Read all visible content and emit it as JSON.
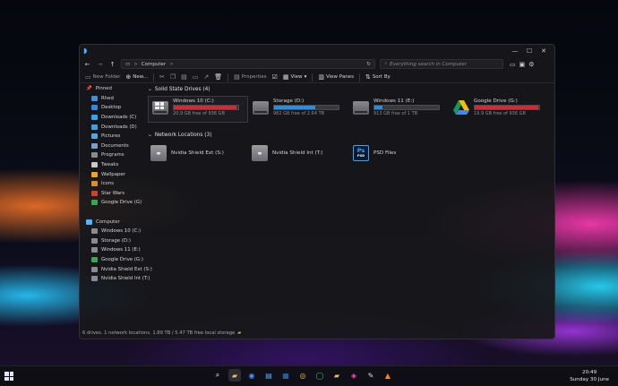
{
  "window": {
    "address": {
      "segments": [
        "Computer"
      ],
      "separator": ">"
    },
    "search": {
      "placeholder": "Everything search in Computer"
    },
    "toolbar": {
      "new_folder": "New Folder",
      "new": "New...",
      "properties": "Properties",
      "view": "View",
      "view_panes": "View Panes",
      "sort_by": "Sort By"
    },
    "sidebar": {
      "pinned_label": "Pinned",
      "pinned": [
        {
          "label": "Rhed",
          "color": "#3d8fe0"
        },
        {
          "label": "Desktop",
          "color": "#2f86e6"
        },
        {
          "label": "Downloads (C)",
          "color": "#3aa0e8"
        },
        {
          "label": "Downloads (D)",
          "color": "#3aa0e8"
        },
        {
          "label": "Pictures",
          "color": "#4fa6e8"
        },
        {
          "label": "Documents",
          "color": "#7aa0c8"
        },
        {
          "label": "Programs",
          "color": "#8a8a92"
        },
        {
          "label": "Tweaks",
          "color": "#c8c8c8"
        },
        {
          "label": "Wallpaper",
          "color": "#f0a030"
        },
        {
          "label": "Icons",
          "color": "#e08a30"
        },
        {
          "label": "Star Wars",
          "color": "#d04030"
        },
        {
          "label": "Google Drive (G)",
          "color": "#34a853"
        }
      ],
      "computer_label": "Computer",
      "computer": [
        {
          "label": "Windows 10 (C:)",
          "color": "#8a8a92"
        },
        {
          "label": "Storage (D:)",
          "color": "#8a8a92"
        },
        {
          "label": "Windows 11 (E:)",
          "color": "#8a8a92"
        },
        {
          "label": "Google Drive (G:)",
          "color": "#34a853"
        },
        {
          "label": "Nvidia Shield Ext (S:)",
          "color": "#8a8a92"
        },
        {
          "label": "Nvidia Shield Int (T:)",
          "color": "#8a8a92"
        }
      ]
    },
    "drives_group": {
      "label": "Solid State Drives (4)"
    },
    "drives": [
      {
        "name": "Windows 10 (C:)",
        "free": "20.9 GB free of 936 GB",
        "used_fraction": 0.978,
        "bar_color": "#d42a35",
        "icon": "windows-drive-icon"
      },
      {
        "name": "Storage (D:)",
        "free": "982 GB free of 2.64 TB",
        "used_fraction": 0.64,
        "bar_color": "#2b8ce0",
        "icon": "hard-drive-icon"
      },
      {
        "name": "Windows 11 (E:)",
        "free": "913 GB free of 1 TB",
        "used_fraction": 0.12,
        "bar_color": "#2b8ce0",
        "icon": "hard-drive-icon"
      },
      {
        "name": "Google Drive (G:)",
        "free": "19.9 GB free of 936 GB",
        "used_fraction": 0.98,
        "bar_color": "#d42a35",
        "icon": "google-drive-icon"
      }
    ],
    "network_group": {
      "label": "Network Locations (3)"
    },
    "network": [
      {
        "name": "Nvidia Shield Ext (S:)",
        "icon": "network-drive-icon"
      },
      {
        "name": "Nvidia Shield Int (T:)",
        "icon": "network-drive-icon"
      },
      {
        "name": "PSD Files",
        "icon": "photoshop-icon"
      }
    ],
    "status": "6 drives. 1 network locations. 1.89 TB / 5.47 TB free local storage"
  },
  "taskbar": {
    "clock_time": "20:49",
    "clock_date": "Sunday 30 June"
  }
}
